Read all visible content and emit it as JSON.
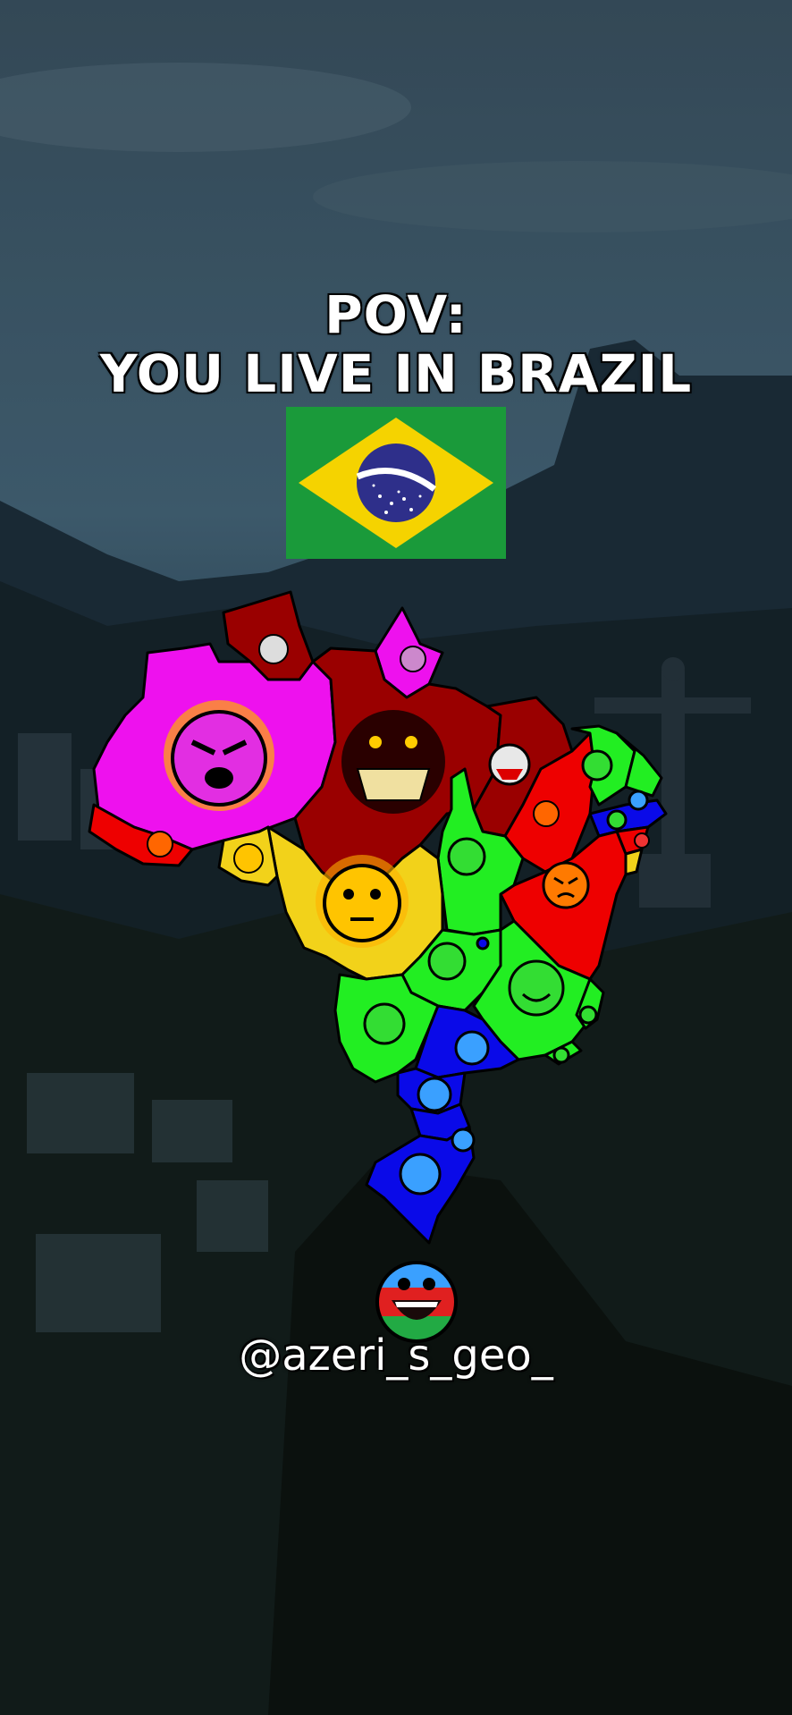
{
  "title": {
    "line1": "POV:",
    "line2": "YOU LIVE IN BRAZIL"
  },
  "flag": {
    "name": "brazil-flag",
    "colors": {
      "green": "#1a9a3a",
      "yellow": "#f5d300",
      "blue": "#2e2f8a"
    }
  },
  "map": {
    "country": "Brazil",
    "region_colors": {
      "magenta": "#ee11ee",
      "dark_red": "#9a0000",
      "red": "#ee0000",
      "yellow": "#f2d21a",
      "green": "#22ee22",
      "blue": "#0a0ae8"
    },
    "face_icons": [
      "angry-face-icon",
      "demon-face-icon",
      "mad-face-icon",
      "neutral-face-icon",
      "smile-face-icon",
      "happy-face-icon"
    ]
  },
  "watermark": {
    "handle": "@azeri_s_geo_",
    "avatar_icon": "azerbaijan-smile-avatar"
  }
}
